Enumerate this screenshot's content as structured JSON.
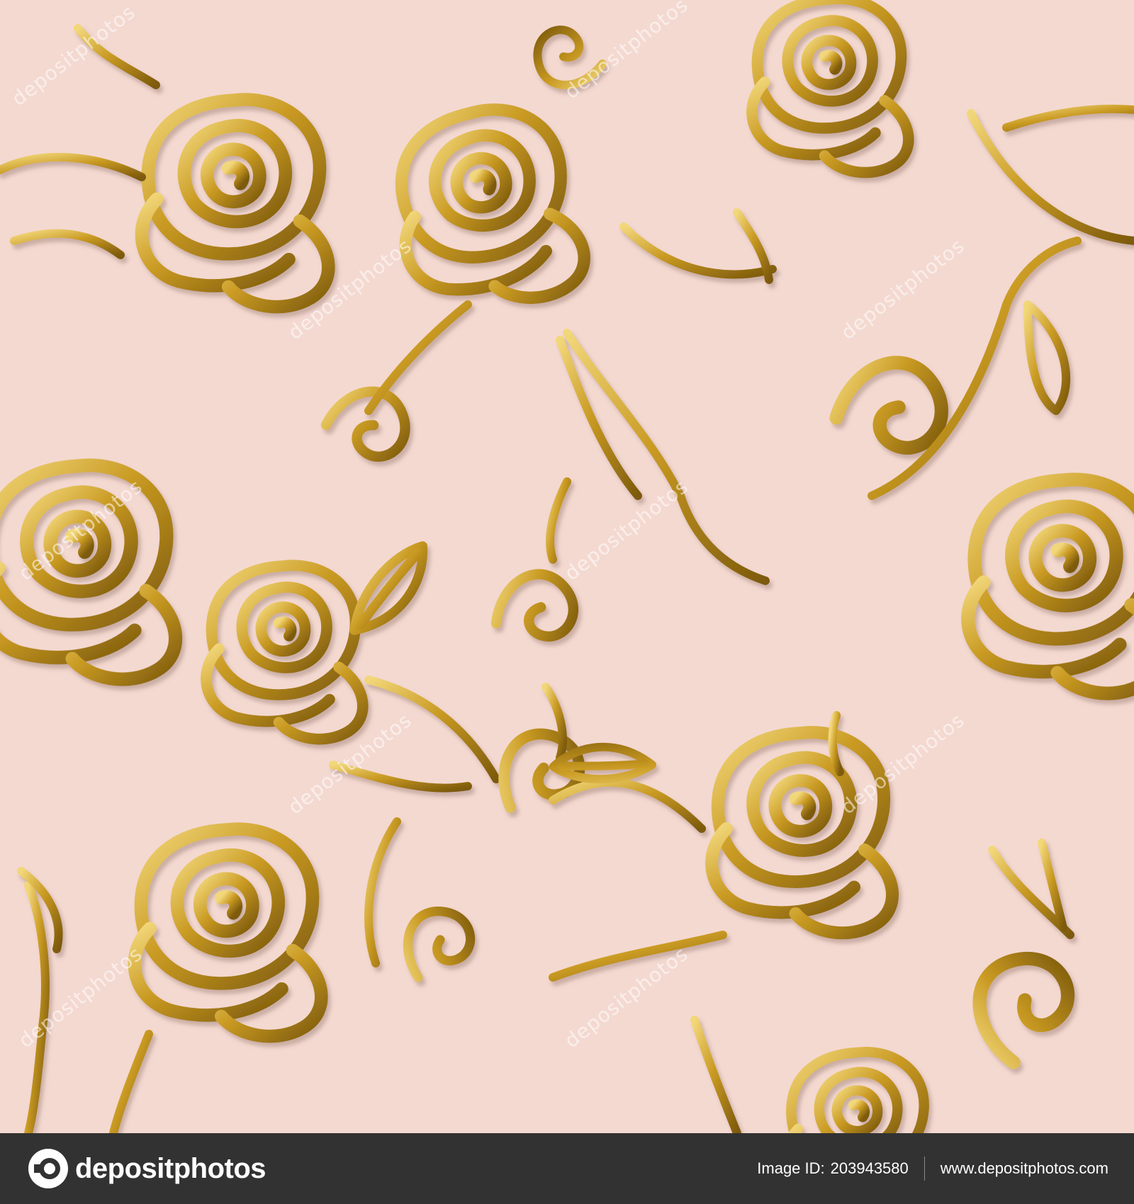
{
  "image": {
    "subject": "seamless pattern of golden outlined roses with swirls on pale pink background",
    "background_color": "#f4d9d1",
    "accent_color": "#b8901e"
  },
  "watermark": {
    "text": "depositphotos"
  },
  "footer": {
    "brand_name": "depositphotos",
    "brand_icon": "depositphotos-logo-icon",
    "image_id_label": "Image ID:",
    "image_id": "203943580",
    "website": "www.depositphotos.com",
    "background_color": "#323232"
  }
}
